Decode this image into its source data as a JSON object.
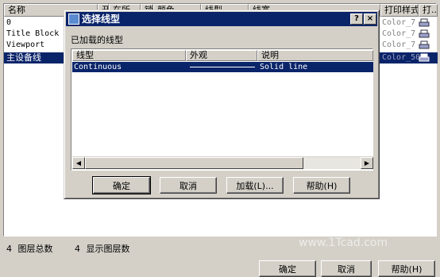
{
  "background": {
    "columns": [
      "名称",
      "开",
      "在所",
      "锁",
      "颜色",
      "线型",
      "线宽",
      "打印样式",
      "打..."
    ],
    "rows": [
      {
        "name": "0",
        "style": "Color_7",
        "selected": false
      },
      {
        "name": "Title Block",
        "style": "Color_7",
        "selected": false
      },
      {
        "name": "Viewport",
        "style": "Color_7",
        "selected": false
      },
      {
        "name": "主设备线",
        "style": "Color_50",
        "selected": true
      }
    ],
    "status": {
      "total_count": "4",
      "total_label": "图层总数",
      "shown_count": "4",
      "shown_label": "显示图层数"
    },
    "buttons": {
      "ok": "确定",
      "cancel": "取消",
      "help": "帮助(H)"
    }
  },
  "dialog": {
    "title": "选择线型",
    "help_button": "?",
    "close_button": "×",
    "loaded_label": "已加载的线型",
    "columns": {
      "linetype": "线型",
      "appearance": "外观",
      "description": "说明"
    },
    "rows": [
      {
        "linetype": "Continuous",
        "description": "Solid line",
        "selected": true
      }
    ],
    "buttons": {
      "ok": "确定",
      "cancel": "取消",
      "load": "加载(L)...",
      "help": "帮助(H)"
    }
  },
  "watermark": "www.1Tcad.com"
}
